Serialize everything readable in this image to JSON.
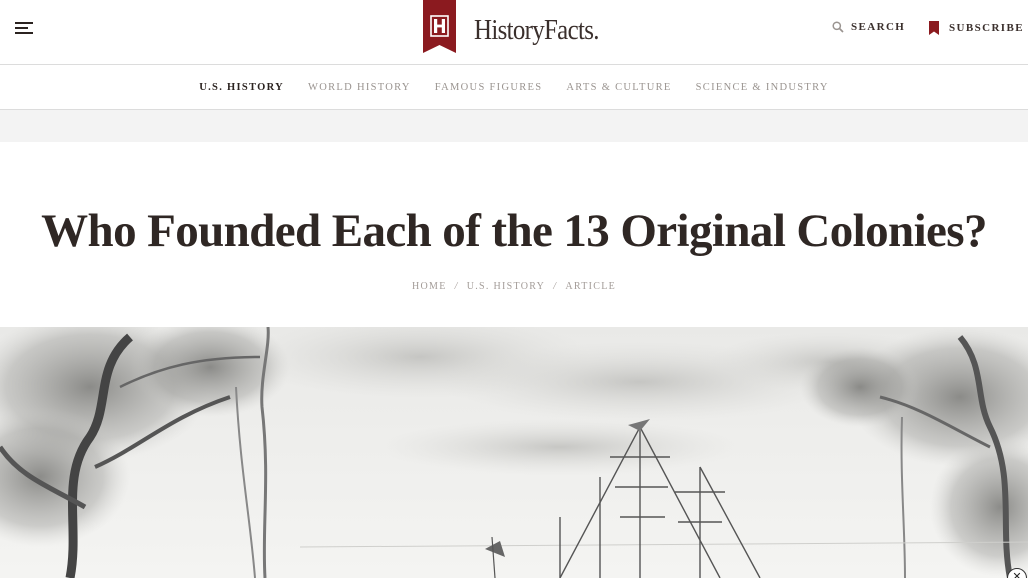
{
  "header": {
    "logo_text": "HistoryFacts.",
    "search_label": "SEARCH",
    "subscribe_label": "SUBSCRIBE",
    "accent_color": "#8b1a1f"
  },
  "nav": {
    "items": [
      "U.S. HISTORY",
      "WORLD HISTORY",
      "FAMOUS FIGURES",
      "ARTS & CULTURE",
      "SCIENCE & INDUSTRY"
    ],
    "active": "U.S. HISTORY"
  },
  "article": {
    "title": "Who Founded Each of the 13 Original Colonies?",
    "breadcrumb": [
      "HOME",
      "U.S. HISTORY",
      "ARTICLE"
    ],
    "breadcrumb_separator": "/"
  },
  "icons": {
    "menu": "hamburger-menu-icon",
    "search": "search-icon",
    "subscribe": "bookmark-icon",
    "close": "close-icon"
  },
  "close_glyph": "✕"
}
